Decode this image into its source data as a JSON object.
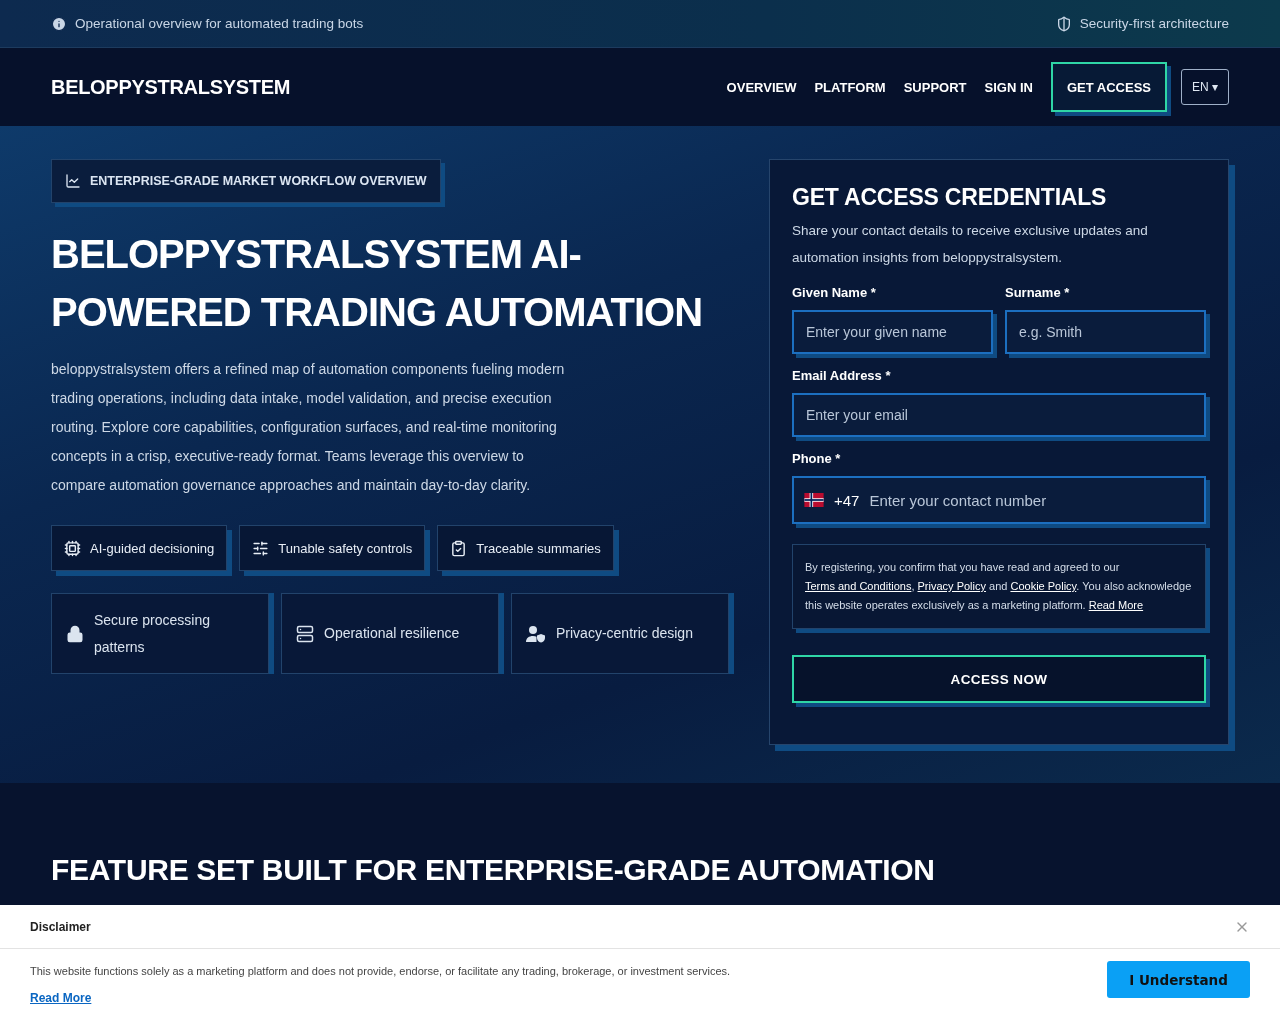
{
  "top_bar": {
    "notice": "Operational overview for automated trading bots",
    "badge": "Security-first architecture"
  },
  "nav": {
    "brand": "BELOPPYSTRALSYSTEM",
    "links": [
      "OVERVIEW",
      "PLATFORM",
      "SUPPORT",
      "SIGN IN"
    ],
    "cta": "GET ACCESS",
    "language": "EN ▾"
  },
  "hero": {
    "eyebrow": "ENTERPRISE-GRADE MARKET WORKFLOW OVERVIEW",
    "title": "BELOPPYSTRALSYSTEM AI-POWERED TRADING AUTOMATION",
    "description": "beloppystralsystem offers a refined map of automation components fueling modern trading operations, including data intake, model validation, and precise execution routing. Explore core capabilities, configuration surfaces, and real-time monitoring concepts in a crisp, executive-ready format. Teams leverage this overview to compare automation governance approaches and maintain day-to-day clarity.",
    "chips": [
      "AI-guided decisioning",
      "Tunable safety controls",
      "Traceable summaries"
    ],
    "cards": [
      "Secure processing patterns",
      "Operational resilience",
      "Privacy-centric design"
    ]
  },
  "form": {
    "title": "GET ACCESS CREDENTIALS",
    "intro": "Share your contact details to receive exclusive updates and automation insights from beloppystralsystem.",
    "given_name": {
      "label": "Given Name *",
      "placeholder": "Enter your given name"
    },
    "surname": {
      "label": "Surname *",
      "placeholder": "e.g. Smith"
    },
    "email": {
      "label": "Email Address *",
      "placeholder": "Enter your email"
    },
    "phone": {
      "label": "Phone *",
      "dial_code": "+47",
      "placeholder": "Enter your contact number"
    },
    "consent": [
      {
        "kind": "text",
        "text": "By registering, you confirm that you have read and agreed to our "
      },
      {
        "kind": "link",
        "text": "Terms and Conditions"
      },
      {
        "kind": "text",
        "text": ", "
      },
      {
        "kind": "link",
        "text": "Privacy Policy"
      },
      {
        "kind": "text",
        "text": " and "
      },
      {
        "kind": "link",
        "text": "Cookie Policy"
      },
      {
        "kind": "text",
        "text": ". You also acknowledge this website operates exclusively as a marketing platform. "
      },
      {
        "kind": "link",
        "text": "Read More"
      }
    ],
    "submit": "ACCESS NOW"
  },
  "features": {
    "heading": "FEATURE SET BUILT FOR ENTERPRISE-GRADE AUTOMATION"
  },
  "disclaimer": {
    "title": "Disclaimer",
    "text": "This website functions solely as a marketing platform and does not provide, endorse, or facilitate any trading, brokerage, or investment services.",
    "link": "Read More",
    "button": "I Understand"
  }
}
